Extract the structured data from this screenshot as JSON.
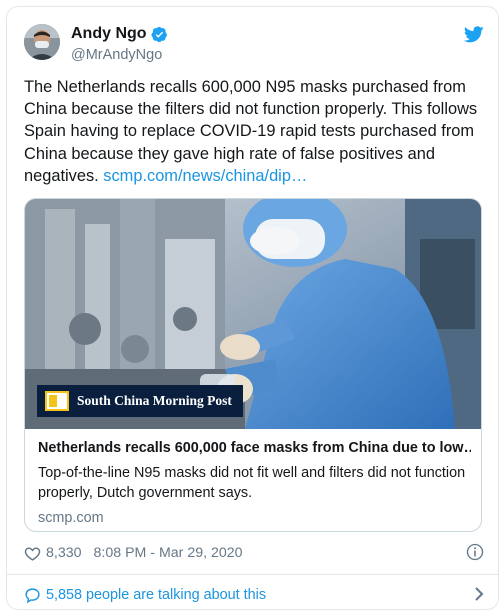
{
  "author": {
    "name": "Andy Ngo",
    "handle": "@MrAndyNgo",
    "verified_icon": "verified-badge-icon"
  },
  "tweet": {
    "text": "The Netherlands recalls 600,000 N95 masks purchased from China because the filters did not function properly. This follows Spain having to replace COVID-19 rapid tests purchased from China because they gave high rate of false positives and negatives. ",
    "link_text": "scmp.com/news/china/dip…"
  },
  "card": {
    "logo_text": "South China Morning Post",
    "title": "Netherlands recalls 600,000 face masks from China due to low…",
    "description": "Top-of-the-line N95 masks did not fit well and filters did not function properly, Dutch government says.",
    "domain": "scmp.com"
  },
  "meta": {
    "likes": "8,330",
    "timestamp": "8:08 PM - Mar 29, 2020"
  },
  "footer": {
    "talking": "5,858 people are talking about this"
  },
  "colors": {
    "accent": "#1b95e0",
    "text": "#14171a",
    "secondary": "#657786",
    "border": "#e1e8ed"
  }
}
